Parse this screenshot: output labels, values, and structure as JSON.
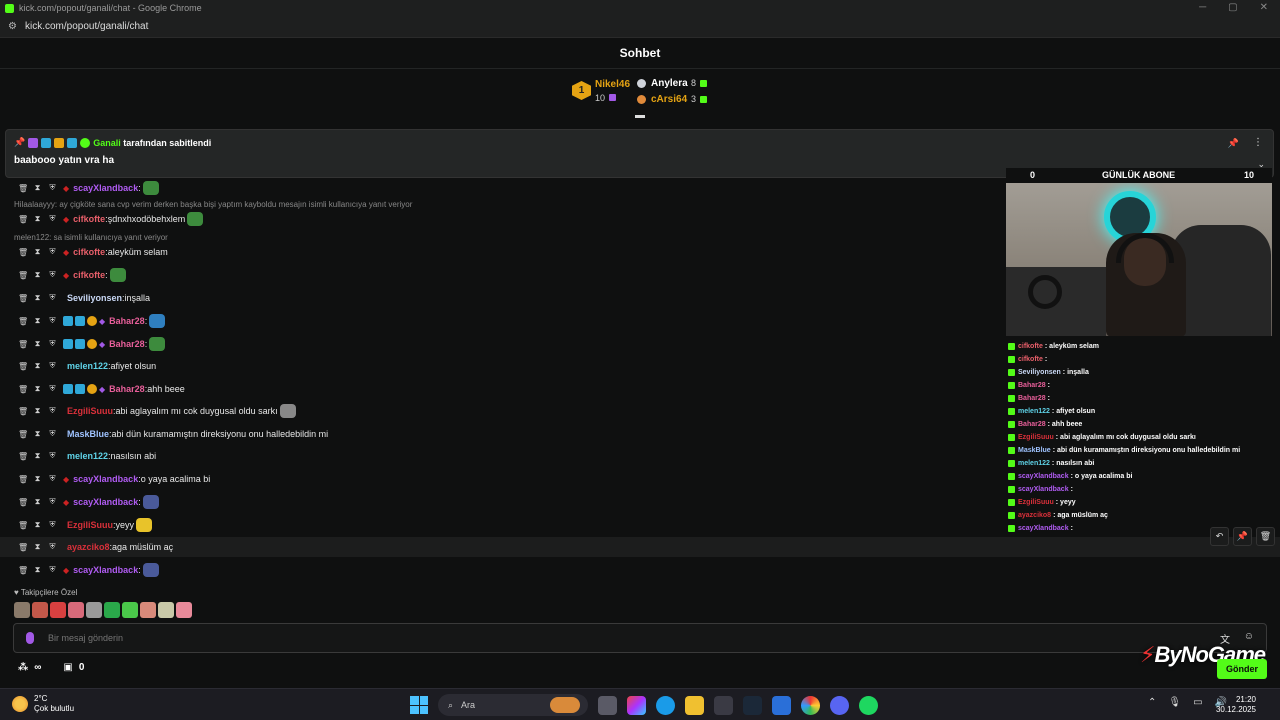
{
  "window": {
    "title": "kick.com/popout/ganali/chat - Google Chrome",
    "url": "kick.com/popout/ganali/chat",
    "controls": [
      "─",
      "▢",
      "✕"
    ]
  },
  "header": {
    "title": "Sohbet"
  },
  "leaderboard": {
    "first": {
      "rank": "1",
      "name": "Nikel46",
      "count": "10",
      "color": "#e5a313"
    },
    "second": {
      "name": "Anylera",
      "count": "8"
    },
    "third": {
      "name": "cArsi64",
      "count": "3"
    }
  },
  "pinned": {
    "by_user": "Ganali",
    "by_suffix": "tarafından sabitlendi",
    "message": "baabooo yatın vra ha"
  },
  "messages": [
    {
      "user": "scayXlandback",
      "color": "#b05cf2",
      "sub": true,
      "text": "",
      "emote": "#3d8b3d"
    },
    {
      "reply": "Hilaalaayyy: ay çigköte sana cvp verim derken başka bişi yaptım kayboldu mesajın isimli kullanıcıya yanıt veriyor"
    },
    {
      "user": "cifkofte",
      "color": "#e85f6a",
      "sub": true,
      "text": "şdnxhxodöbehxlem",
      "emote": "#3d8b3d"
    },
    {
      "reply": "melen122: sa isimli kullanıcıya yanıt veriyor"
    },
    {
      "user": "cifkofte",
      "color": "#e85f6a",
      "sub": true,
      "text": "aleyküm selam"
    },
    {
      "user": "cifkofte",
      "color": "#e85f6a",
      "sub": true,
      "text": "",
      "emote": "#3d8b3d"
    },
    {
      "user": "Seviliyonsen",
      "color": "#c9d8f5",
      "text": "inşalla"
    },
    {
      "user": "Bahar28",
      "color": "#e85f9a",
      "vip": true,
      "text": "",
      "emote": "#2f7fbf"
    },
    {
      "user": "Bahar28",
      "color": "#e85f9a",
      "vip": true,
      "text": "",
      "emote": "#3d8b3d"
    },
    {
      "user": "melen122",
      "color": "#5fd3e8",
      "text": "afiyet olsun"
    },
    {
      "user": "Bahar28",
      "color": "#e85f9a",
      "vip": true,
      "text": "ahh beee"
    },
    {
      "user": "EzgiliSuuu",
      "color": "#d9303a",
      "text": "abi aglayalım mı cok duygusal oldu sarkı",
      "emote": "#888888"
    },
    {
      "user": "MaskBlue",
      "color": "#9fc3ff",
      "text": "abi dün kuramamıştın direksiyonu onu halledebildin mi"
    },
    {
      "user": "melen122",
      "color": "#5fd3e8",
      "text": "nasılsın abi"
    },
    {
      "user": "scayXlandback",
      "color": "#b05cf2",
      "sub": true,
      "text": "o yaya acalima bi"
    },
    {
      "user": "scayXlandback",
      "color": "#b05cf2",
      "sub": true,
      "text": "",
      "emote": "#4a5a9a"
    },
    {
      "user": "EzgiliSuuu",
      "color": "#d9303a",
      "text": "yeyy",
      "emote": "#e8c32a"
    },
    {
      "user": "ayazciko8",
      "color": "#d9303a",
      "text": "aga müslüm aç"
    },
    {
      "user": "scayXlandback",
      "color": "#b05cf2",
      "sub": true,
      "text": "",
      "emote": "#4a5a9a"
    }
  ],
  "overlay": {
    "abone_left": "0",
    "abone_title": "GÜNLÜK ABONE",
    "abone_right": "10",
    "mini_chat": [
      {
        "user": "cifkofte",
        "color": "#e85f6a",
        "text": ": aleyküm selam"
      },
      {
        "user": "cifkofte",
        "color": "#e85f6a",
        "text": ":"
      },
      {
        "user": "Seviliyonsen",
        "color": "#c9d8f5",
        "text": ": inşalla"
      },
      {
        "user": "Bahar28",
        "color": "#e85f9a",
        "text": ":"
      },
      {
        "user": "Bahar28",
        "color": "#e85f9a",
        "text": ":"
      },
      {
        "user": "melen122",
        "color": "#5fd3e8",
        "text": ": afiyet olsun"
      },
      {
        "user": "Bahar28",
        "color": "#e85f9a",
        "text": ": ahh beee"
      },
      {
        "user": "EzgiliSuuu",
        "color": "#d9303a",
        "text": ": abi aglayalım mı cok duygusal oldu sarkı"
      },
      {
        "user": "MaskBlue",
        "color": "#9fc3ff",
        "text": ": abi dün kuramamıştın direksiyonu onu halledebildin mi"
      },
      {
        "user": "melen122",
        "color": "#5fd3e8",
        "text": ": nasılsın abi"
      },
      {
        "user": "scayXlandback",
        "color": "#b05cf2",
        "text": ": o yaya acalima bi"
      },
      {
        "user": "scayXlandback",
        "color": "#b05cf2",
        "text": ":"
      },
      {
        "user": "EzgiliSuuu",
        "color": "#d9303a",
        "text": ": yeyy"
      },
      {
        "user": "ayazciko8",
        "color": "#d9303a",
        "text": ": aga müslüm aç"
      },
      {
        "user": "scayXlandback",
        "color": "#b05cf2",
        "text": ":"
      }
    ]
  },
  "follower_emotes": {
    "label": "Takipçilere Özel",
    "colors": [
      "#8a7a6a",
      "#c4584a",
      "#d84040",
      "#d86a7a",
      "#9a9a9a",
      "#2aa84a",
      "#4ac84a",
      "#d88a7a",
      "#c8c8a8",
      "#e88a9a"
    ]
  },
  "input": {
    "placeholder": "Bir mesaj gönderin"
  },
  "bottom": {
    "points": "∞",
    "gift_count": "0",
    "send_label": "Gönder"
  },
  "watermark": "ByNoGame",
  "taskbar": {
    "temp": "2°C",
    "weather": "Çok bulutlu",
    "search": "Ara",
    "time": "21:20",
    "date": "30.12.2025"
  },
  "accent": "#53fc18"
}
